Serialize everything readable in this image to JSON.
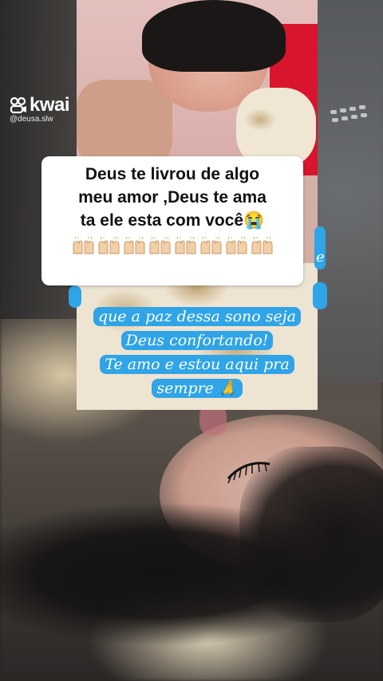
{
  "watermark": {
    "brand": "kwai",
    "handle": "@deusa.slw"
  },
  "caption": {
    "lines": [
      "Deus te livrou de algo",
      "meu amor ,Deus te ama",
      "ta ele esta com você😭"
    ],
    "emoji_row_count": 8,
    "emoji_name": "raising-hands-emoji"
  },
  "overlay_text": {
    "lines": [
      "que a paz dessa sono seja",
      "Deus confortando!",
      "Te amo e estou aqui pra",
      "sempre 🙏"
    ],
    "background_color": "#2fa4e7"
  },
  "partial_text_right": "e",
  "colors": {
    "caption_bg": "#ffffff",
    "bubble_blue": "#2fa4e7",
    "accent_red": "#d8152c"
  }
}
